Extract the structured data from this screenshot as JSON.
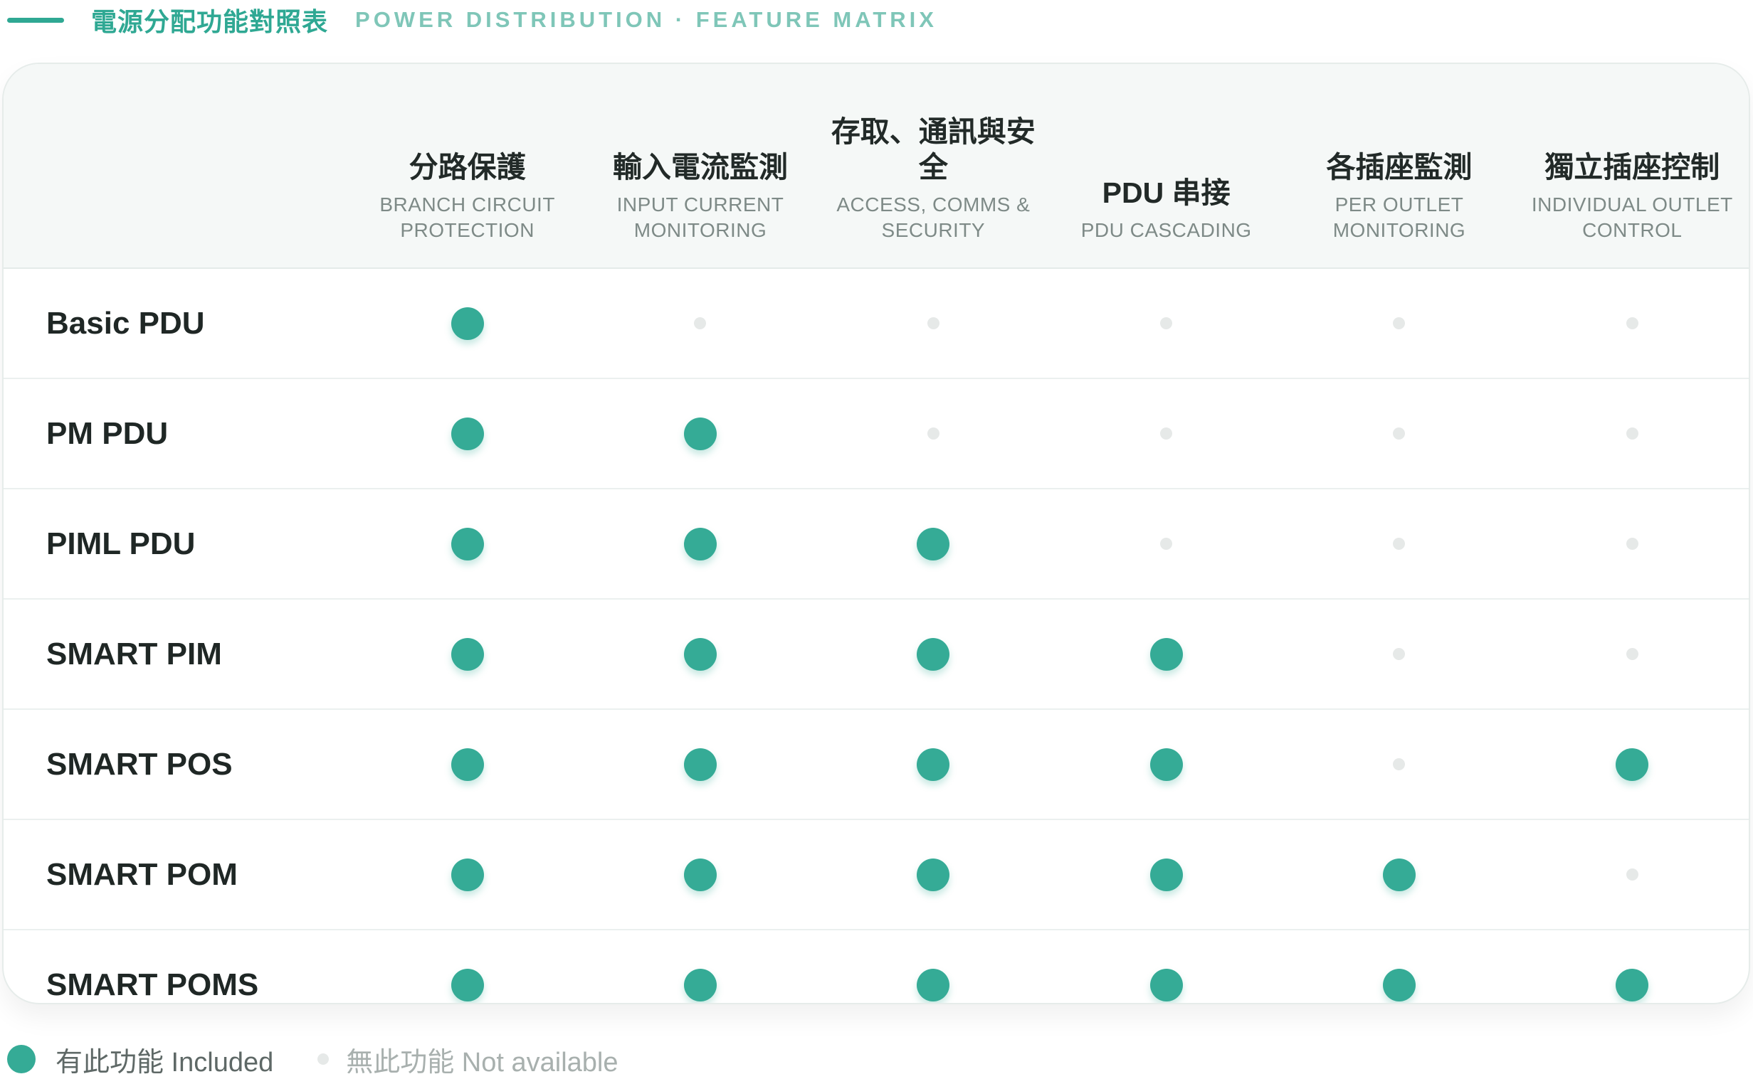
{
  "header": {
    "title_zh": "電源分配功能對照表",
    "title_en": "POWER DISTRIBUTION · FEATURE MATRIX"
  },
  "columns": [
    {
      "zh": "分路保護",
      "en": "BRANCH CIRCUIT PROTECTION"
    },
    {
      "zh": "輸入電流監測",
      "en": "INPUT CURRENT MONITORING"
    },
    {
      "zh": "存取、通訊與安全",
      "en": "ACCESS, COMMS & SECURITY"
    },
    {
      "zh": "PDU 串接",
      "en": "PDU CASCADING"
    },
    {
      "zh": "各插座監測",
      "en": "PER OUTLET MONITORING"
    },
    {
      "zh": "獨立插座控制",
      "en": "INDIVIDUAL OUTLET CONTROL"
    }
  ],
  "rows": [
    {
      "name": "Basic PDU",
      "features": [
        true,
        false,
        false,
        false,
        false,
        false
      ]
    },
    {
      "name": "PM PDU",
      "features": [
        true,
        true,
        false,
        false,
        false,
        false
      ]
    },
    {
      "name": "PIML PDU",
      "features": [
        true,
        true,
        true,
        false,
        false,
        false
      ]
    },
    {
      "name": "SMART PIM",
      "features": [
        true,
        true,
        true,
        true,
        false,
        false
      ]
    },
    {
      "name": "SMART POS",
      "features": [
        true,
        true,
        true,
        true,
        false,
        true
      ]
    },
    {
      "name": "SMART POM",
      "features": [
        true,
        true,
        true,
        true,
        true,
        false
      ]
    },
    {
      "name": "SMART POMS",
      "features": [
        true,
        true,
        true,
        true,
        true,
        true
      ]
    }
  ],
  "legend": {
    "included": "有此功能 Included",
    "not_available": "無此功能 Not available"
  },
  "colors": {
    "accent": "#35ab96",
    "inactive": "#e6e9e8"
  }
}
